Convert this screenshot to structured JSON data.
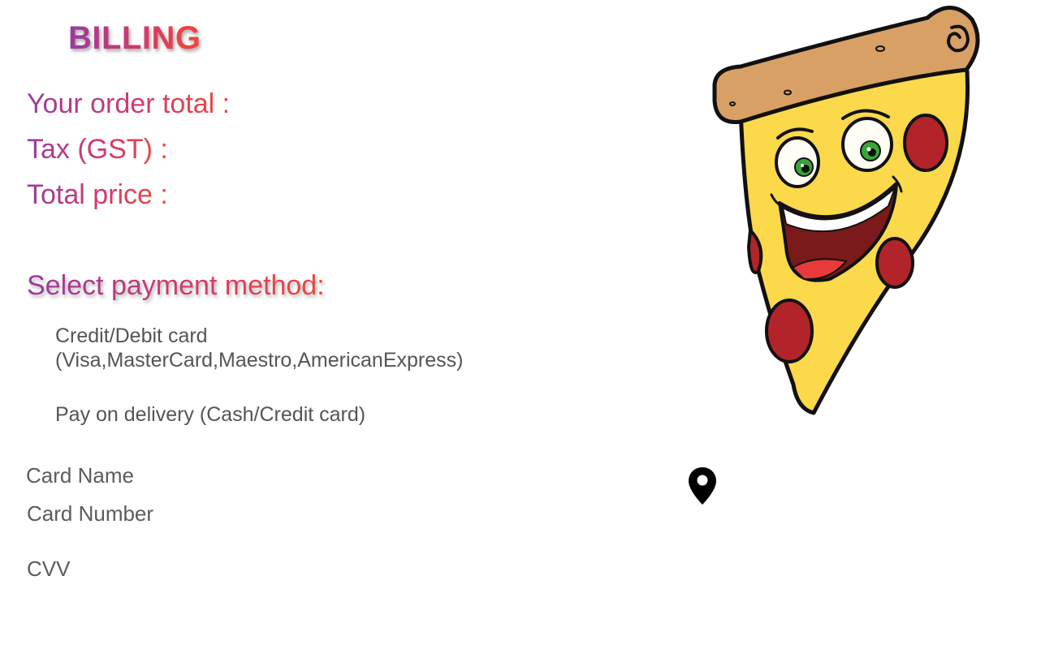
{
  "billing": {
    "title": "BILLING",
    "order_total_label": "Your order total :",
    "tax_label": "Tax (GST) :",
    "total_price_label": "Total price :"
  },
  "payment": {
    "heading": "Select payment method:",
    "options": [
      {
        "line1": "Credit/Debit card",
        "line2": "(Visa,MasterCard,Maestro,AmericanExpress)"
      },
      {
        "line1": "Pay on delivery (Cash/Credit card)"
      }
    ]
  },
  "card_form": {
    "name_label": "Card Name",
    "number_label": "Card Number",
    "cvv_label": "CVV"
  },
  "icons": {
    "illustration": "pizza-mascot-icon",
    "location": "location-pin-icon"
  },
  "colors": {
    "gradient_start": "#9b3aa0",
    "gradient_end": "#f0473a",
    "label_gray": "#5c5c5c"
  }
}
